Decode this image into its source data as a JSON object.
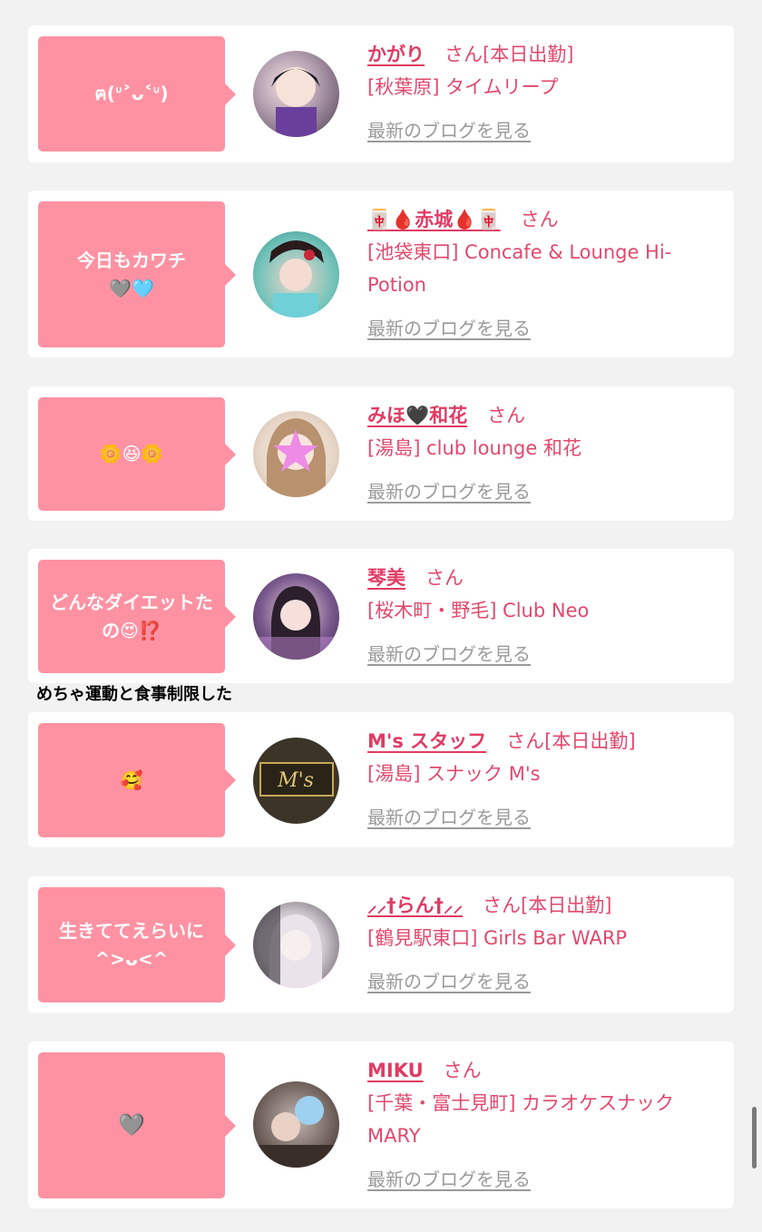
{
  "cards": [
    {
      "bubble": "ฅ(ᐡ˃ᴗ˂ᐡ)",
      "name": "かがり",
      "san": "さん",
      "badge": "[本日出勤]",
      "store": "[秋葉原] タイムリープ",
      "blog": "最新のブログを見る"
    },
    {
      "bubble": "今日もカワチ",
      "bubble_extra": "🩶🩵",
      "name": "🀄🩸赤城🩸🀄",
      "san": "さん",
      "badge": "",
      "store": "[池袋東口] Concafe & Lounge Hi-Potion",
      "blog": "最新のブログを見る"
    },
    {
      "bubble": "🌼😆🌼",
      "name": "みほ🖤和花",
      "san": "さん",
      "badge": "",
      "store": "[湯島] club lounge 和花",
      "blog": "最新のブログを見る"
    },
    {
      "bubble": "どんなダイエットたの😍⁉️",
      "name": "琴美",
      "san": "さん",
      "badge": "",
      "store": "[桜木町・野毛] Club Neo",
      "blog": "最新のブログを見る"
    },
    {
      "bubble": "🥰",
      "name": "M's スタッフ",
      "san": "さん",
      "badge": "[本日出勤]",
      "store": "[湯島] スナック M's",
      "blog": "最新のブログを見る"
    },
    {
      "bubble": "生きててえらいに ^>ᴗ<^",
      "name": "⸝⸝†らん†⸝⸝",
      "san": "さん",
      "badge": "[本日出勤]",
      "store": "[鶴見駅東口] Girls Bar WARP",
      "blog": "最新のブログを見る"
    },
    {
      "bubble": "🩶",
      "name": "MIKU",
      "san": "さん",
      "badge": "",
      "store": "[千葉・富士見町] カラオケスナック MARY",
      "blog": "最新のブログを見る"
    }
  ],
  "overflow_text": "めちゃ運動と食事制限した",
  "colors": {
    "background": "#f2f2f2",
    "card": "#ffffff",
    "bubble": "#ff92a2",
    "name": "#e03b63",
    "text": "#e2486c",
    "link_gray": "#9a9a9a"
  }
}
